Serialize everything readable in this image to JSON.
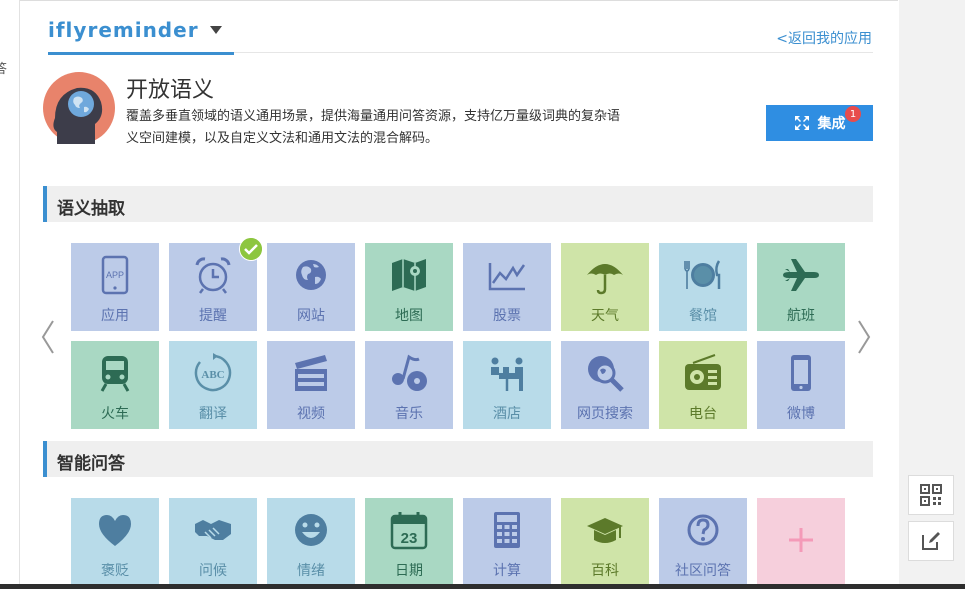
{
  "header": {
    "app_name": "iflyreminder",
    "back_link": "<返回我的应用"
  },
  "feature": {
    "title": "开放语义",
    "description_line1": "覆盖多垂直领域的语义通用场景，提供海量通用问答资源，支持亿万量级词典的复杂语",
    "description_line2": "义空间建模，以及自定义文法和通用文法的混合解码。",
    "integrate_label": "集成",
    "badge_count": "1"
  },
  "sections": {
    "extraction_title": "语义抽取",
    "qa_title": "智能问答"
  },
  "extraction_tiles": [
    {
      "label": "应用",
      "icon": "tablet-app-icon",
      "color": "blue"
    },
    {
      "label": "提醒",
      "icon": "alarm-clock-icon",
      "color": "blue",
      "selected": true
    },
    {
      "label": "网站",
      "icon": "globe-icon",
      "color": "blue"
    },
    {
      "label": "地图",
      "icon": "map-icon",
      "color": "teal"
    },
    {
      "label": "股票",
      "icon": "stock-chart-icon",
      "color": "blue"
    },
    {
      "label": "天气",
      "icon": "umbrella-icon",
      "color": "green"
    },
    {
      "label": "餐馆",
      "icon": "dining-icon",
      "color": "lblue"
    },
    {
      "label": "航班",
      "icon": "airplane-icon",
      "color": "teal"
    },
    {
      "label": "火车",
      "icon": "train-icon",
      "color": "teal"
    },
    {
      "label": "翻译",
      "icon": "abc-translate-icon",
      "color": "lblue"
    },
    {
      "label": "视频",
      "icon": "clapperboard-icon",
      "color": "blue"
    },
    {
      "label": "音乐",
      "icon": "music-note-icon",
      "color": "blue"
    },
    {
      "label": "酒店",
      "icon": "hotel-reception-icon",
      "color": "lblue"
    },
    {
      "label": "网页搜索",
      "icon": "web-search-icon",
      "color": "blue"
    },
    {
      "label": "电台",
      "icon": "radio-icon",
      "color": "green"
    },
    {
      "label": "微博",
      "icon": "mobile-phone-icon",
      "color": "blue"
    }
  ],
  "qa_tiles": [
    {
      "label": "褒贬",
      "icon": "heart-icon",
      "color": "lblue"
    },
    {
      "label": "问候",
      "icon": "handshake-icon",
      "color": "lblue"
    },
    {
      "label": "情绪",
      "icon": "smiley-icon",
      "color": "lblue"
    },
    {
      "label": "日期",
      "icon": "calendar-icon",
      "color": "teal"
    },
    {
      "label": "计算",
      "icon": "calculator-icon",
      "color": "blue"
    },
    {
      "label": "百科",
      "icon": "graduation-cap-icon",
      "color": "green"
    },
    {
      "label": "社区问答",
      "icon": "question-icon",
      "color": "blue"
    },
    {
      "label": "",
      "icon": "plus-icon",
      "color": "pink"
    }
  ],
  "colors": {
    "accent": "#3b8fd0",
    "button": "#2f8ee2",
    "check": "#8dc63f",
    "badge": "#e84c4c"
  }
}
